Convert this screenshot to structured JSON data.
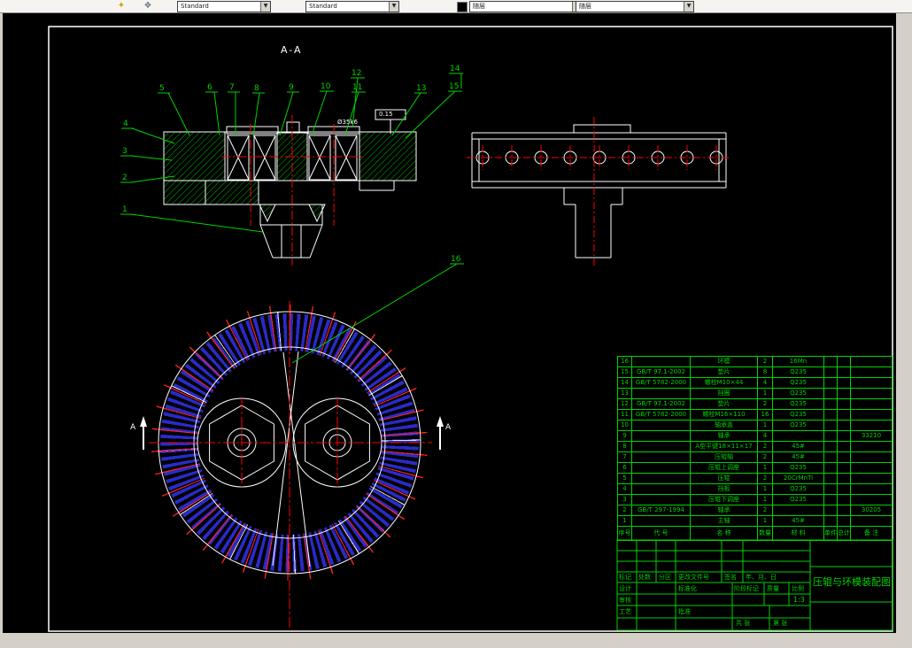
{
  "toolbar": {
    "combo1": "Standard",
    "combo2": "Standard",
    "color_combo": "随层",
    "linetype_combo": "随层",
    "icon1_glyph": "✦",
    "icon2_glyph": "❖"
  },
  "colors": {
    "cad_green": "#00d200",
    "cad_red": "#ff0000",
    "cad_blue": "#2a2ac8",
    "cad_white": "#ffffff"
  },
  "drawing": {
    "section_label": "A-A",
    "tolerance_label": "0.15",
    "dim_label": "Ø35k6",
    "arrow_label_left": "A",
    "arrow_label_right": "A",
    "callouts": [
      "1",
      "2",
      "3",
      "4",
      "5",
      "6",
      "7",
      "8",
      "9",
      "10",
      "11",
      "12",
      "13",
      "14",
      "15",
      "16"
    ]
  },
  "bom": {
    "header": {
      "no": "序号",
      "code": "代 号",
      "name": "名 称",
      "qty": "数量",
      "material": "材 料",
      "unit": "单件",
      "total": "总计",
      "remark": "备 注"
    },
    "rows": [
      {
        "no": "16",
        "code": "",
        "name": "环模",
        "qty": "2",
        "material": "16Mn",
        "remark": ""
      },
      {
        "no": "15",
        "code": "GB/T 97.1-2002",
        "name": "垫片",
        "qty": "8",
        "material": "Q235",
        "remark": ""
      },
      {
        "no": "14",
        "code": "GB/T 5782-2000",
        "name": "螺栓M10×44",
        "qty": "4",
        "material": "Q235",
        "remark": ""
      },
      {
        "no": "13",
        "code": "",
        "name": "挡圈",
        "qty": "1",
        "material": "Q235",
        "remark": ""
      },
      {
        "no": "12",
        "code": "GB/T 97.1-2002",
        "name": "垫片",
        "qty": "2",
        "material": "Q235",
        "remark": ""
      },
      {
        "no": "11",
        "code": "GB/T 5782-2000",
        "name": "螺栓M16×110",
        "qty": "16",
        "material": "Q235",
        "remark": ""
      },
      {
        "no": "10",
        "code": "",
        "name": "轴承盖",
        "qty": "1",
        "material": "Q235",
        "remark": ""
      },
      {
        "no": "9",
        "code": "",
        "name": "轴承",
        "qty": "4",
        "material": "",
        "remark": "33210"
      },
      {
        "no": "8",
        "code": "",
        "name": "A型平键18×11×17",
        "qty": "2",
        "material": "45#",
        "remark": ""
      },
      {
        "no": "7",
        "code": "",
        "name": "压辊轴",
        "qty": "2",
        "material": "45#",
        "remark": ""
      },
      {
        "no": "6",
        "code": "",
        "name": "压辊上调座",
        "qty": "1",
        "material": "Q235",
        "remark": ""
      },
      {
        "no": "5",
        "code": "",
        "name": "压辊",
        "qty": "2",
        "material": "20CrMnTi",
        "remark": ""
      },
      {
        "no": "4",
        "code": "",
        "name": "挡板",
        "qty": "1",
        "material": "Q235",
        "remark": ""
      },
      {
        "no": "3",
        "code": "",
        "name": "压辊下调座",
        "qty": "1",
        "material": "Q235",
        "remark": ""
      },
      {
        "no": "2",
        "code": "GB/T 297-1994",
        "name": "轴承",
        "qty": "2",
        "material": "",
        "remark": "30205"
      },
      {
        "no": "1",
        "code": "",
        "name": "主轴",
        "qty": "1",
        "material": "45#",
        "remark": ""
      }
    ]
  },
  "titleblock": {
    "title": "压辊与环模装配图",
    "scale": "1:3",
    "mark": "标记",
    "count": "处数",
    "zone": "分区",
    "change_doc": "更改文件号",
    "sign": "签名",
    "date": "年、月、日",
    "design": "设计",
    "standardize": "标准化",
    "check": "审核",
    "process": "工艺",
    "approve": "批准",
    "stage": "阶段标记",
    "weight": "质量",
    "scale_label": "比例",
    "sheets_total": "共 张",
    "sheet_no": "第 张"
  }
}
